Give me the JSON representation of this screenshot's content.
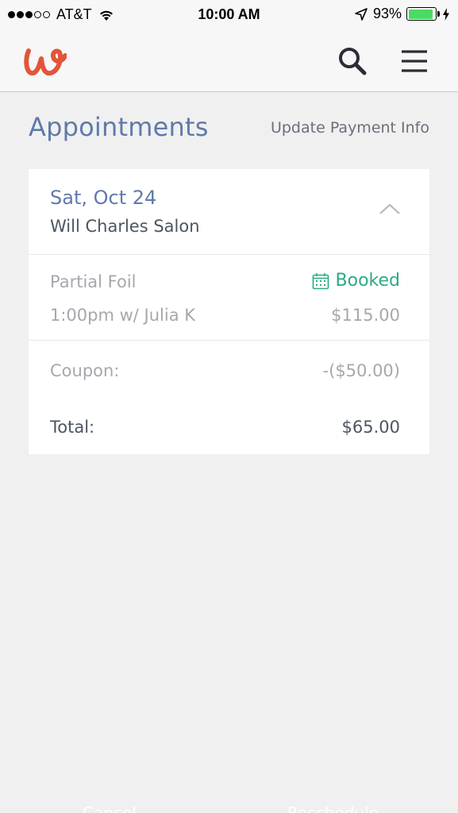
{
  "status_bar": {
    "signal_full": 3,
    "signal_total": 5,
    "carrier": "AT&T",
    "time": "10:00 AM",
    "battery_percent": "93%",
    "battery_level": 0.93,
    "battery_color": "#4cd964",
    "icons": [
      "wifi-icon",
      "location-arrow-icon",
      "battery-icon",
      "charging-bolt-icon"
    ]
  },
  "header": {
    "logo_icon": "w-logo-icon",
    "logo_color": "#e2553b",
    "search_icon": "search-icon",
    "menu_icon": "hamburger-menu-icon"
  },
  "page": {
    "title": "Appointments",
    "update_payment_label": "Update Payment Info",
    "title_color": "#5f7aaa"
  },
  "appointment": {
    "date": "Sat, Oct 24",
    "salon": "Will Charles Salon",
    "collapse_icon": "chevron-up-icon",
    "service": {
      "name": "Partial Foil",
      "time_stylist": "1:00pm w/ Julia K",
      "status": "Booked",
      "status_icon": "calendar-icon",
      "status_color": "#2bab86",
      "price": "$115.00"
    },
    "coupon_label": "Coupon:",
    "coupon_value": "-($50.00)",
    "total_label": "Total:",
    "total_value": "$65.00"
  },
  "bottom_actions": {
    "cancel_label": "Cancel",
    "reschedule_label": "Reschedule"
  }
}
